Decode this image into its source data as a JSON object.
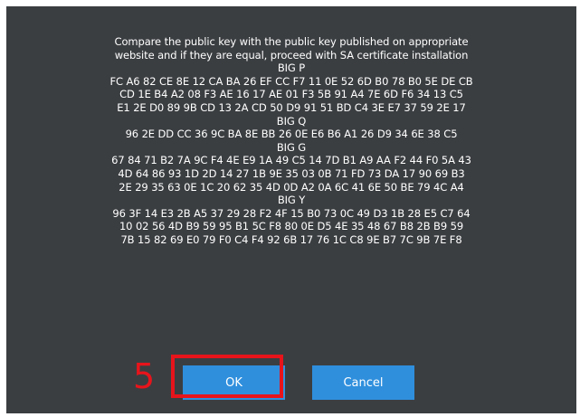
{
  "dialog": {
    "message_lines": [
      "Compare the public key with the public key published on appropriate",
      "website and if they are equal, proceed with SA certificate installation",
      "BIG P",
      "FC A6 82 CE 8E 12 CA BA 26 EF CC F7 11 0E 52 6D B0 78 B0 5E DE CB",
      "CD 1E B4 A2 08 F3 AE 16 17 AE 01 F3 5B 91 A4 7E 6D F6 34 13 C5",
      "E1 2E D0 89 9B CD 13 2A CD 50 D9 91 51 BD C4 3E E7 37 59 2E 17",
      "BIG Q",
      "96 2E DD CC 36 9C BA 8E BB 26 0E E6 B6 A1 26 D9 34 6E 38 C5",
      "BIG G",
      "67 84 71 B2 7A 9C F4 4E E9 1A 49 C5 14 7D B1 A9 AA F2 44 F0 5A 43",
      "4D 64 86 93 1D 2D 14 27 1B 9E 35 03 0B 71 FD 73 DA 17 90 69 B3",
      "2E 29 35 63 0E 1C 20 62 35 4D 0D A2 0A 6C 41 6E 50 BE 79 4C A4",
      "BIG Y",
      "96 3F 14 E3 2B A5 37 29 28 F2 4F 15 B0 73 0C 49 D3 1B 28 E5 C7 64",
      "10 02 56 4D B9 59 95 B1 5C F8 80 0E D5 4E 35 48 67 B8 2B B9 59",
      "7B 15 82 69 E0 79 F0 C4 F4 92 6B 17 76 1C C8 9E B7 7C 9B 7E F8"
    ],
    "ok_label": "OK",
    "cancel_label": "Cancel"
  },
  "annotation": {
    "step_number": "5",
    "color": "#e8141b"
  },
  "colors": {
    "dialog_background": "#3b3e41",
    "button_background": "#2f8fdd",
    "text": "#ffffff"
  }
}
